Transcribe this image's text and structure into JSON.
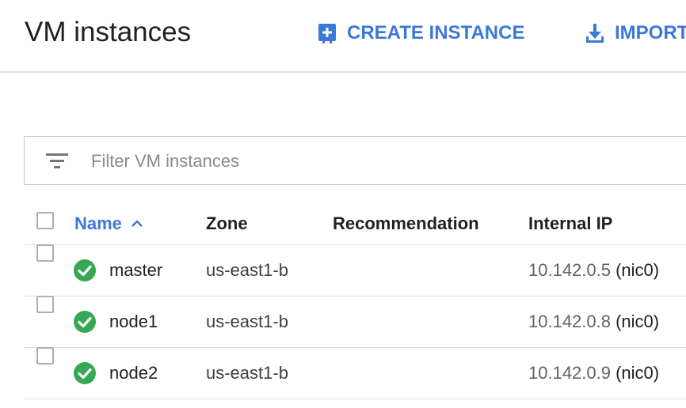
{
  "header": {
    "title": "VM instances",
    "actions": {
      "create": "CREATE INSTANCE",
      "import": "IMPORT VM"
    }
  },
  "filter": {
    "placeholder": "Filter VM instances",
    "value": ""
  },
  "table": {
    "columns": {
      "name": "Name",
      "zone": "Zone",
      "recommendation": "Recommendation",
      "internal_ip": "Internal IP"
    },
    "sort": {
      "column": "Name",
      "direction": "ascending"
    },
    "rows": [
      {
        "status": "running",
        "name": "master",
        "zone": "us-east1-b",
        "recommendation": "",
        "internal_ip": "10.142.0.5",
        "nic": "(nic0)"
      },
      {
        "status": "running",
        "name": "node1",
        "zone": "us-east1-b",
        "recommendation": "",
        "internal_ip": "10.142.0.8",
        "nic": "(nic0)"
      },
      {
        "status": "running",
        "name": "node2",
        "zone": "us-east1-b",
        "recommendation": "",
        "internal_ip": "10.142.0.9",
        "nic": "(nic0)"
      }
    ]
  },
  "colors": {
    "accent": "#3c78d8",
    "status_ok": "#34a853",
    "divider": "#dadce0"
  },
  "icons": {
    "create": "add-box-icon",
    "import": "download-icon",
    "filter": "filter-list-icon",
    "sort": "chevron-up-icon",
    "status": "check-circle-icon"
  }
}
